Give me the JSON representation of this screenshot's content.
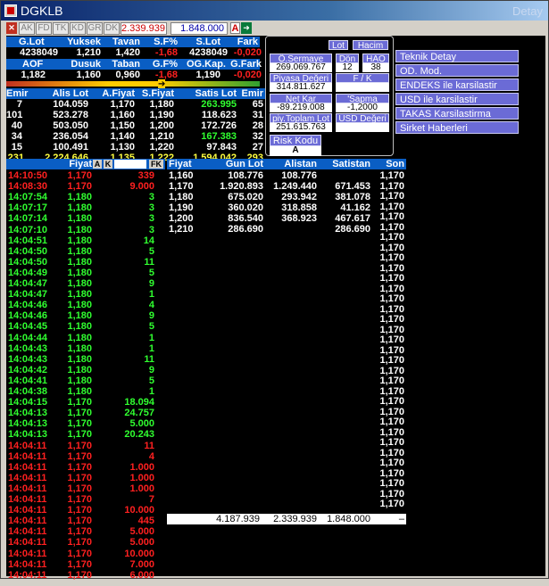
{
  "title": "DGKLB",
  "title_right": "Detay",
  "toolbar": {
    "tabs": [
      "AK",
      "FD",
      "TK",
      "KD",
      "GR",
      "DK"
    ],
    "value1": "2.339.939",
    "value2": "1.848.000",
    "a_label": "A"
  },
  "depth_header1": {
    "glot": "G.Lot",
    "yuksek": "Yuksek",
    "tavan": "Tavan",
    "sf": "S.F%",
    "slot": "S.Lot",
    "fark": "Fark"
  },
  "depth_row1": {
    "glot": "4238049",
    "yuksek": "1,210",
    "tavan": "1,420",
    "sf": "-1,68",
    "slot": "4238049",
    "fark": "-0,020"
  },
  "depth_header2": {
    "aof": "AOF",
    "dusuk": "Dusuk",
    "taban": "Taban",
    "gf": "G.F%",
    "ogkap": "OG.Kap.",
    "gfark": "G.Fark"
  },
  "depth_row2": {
    "aof": "1,182",
    "dusuk": "1,160",
    "taban": "0,960",
    "gf": "-1,68",
    "ogkap": "1,190",
    "gfark": "-0,020"
  },
  "order_header": {
    "emir": "Emir",
    "alis_lot": "Alis Lot",
    "afiyat": "A.Fiyat",
    "sfiyat": "S.Fiyat",
    "satis_lot": "Satis Lot",
    "emir2": "Emir"
  },
  "orders": [
    {
      "e": "7",
      "al": "104.059",
      "af": "1,170",
      "sf": "1,180",
      "sl": "263.995",
      "e2": "65",
      "slc": "g"
    },
    {
      "e": "101",
      "al": "523.278",
      "af": "1,160",
      "sf": "1,190",
      "sl": "118.623",
      "e2": "31",
      "slc": "w"
    },
    {
      "e": "40",
      "al": "503.050",
      "af": "1,150",
      "sf": "1,200",
      "sl": "172.726",
      "e2": "28",
      "slc": "w"
    },
    {
      "e": "34",
      "al": "236.054",
      "af": "1,140",
      "sf": "1,210",
      "sl": "167.383",
      "e2": "32",
      "slc": "g"
    },
    {
      "e": "15",
      "al": "100.491",
      "af": "1,130",
      "sf": "1,220",
      "sl": "97.843",
      "e2": "27",
      "slc": "w"
    }
  ],
  "order_total": {
    "e": "231",
    "al": "2.224.646",
    "af": "1,135",
    "sf": "1,222",
    "sl": "1.594.042",
    "e2": "293"
  },
  "summary": {
    "lot": "Lot",
    "hacim": "Hacim",
    "o_sermaye_label": "Ö.Sermaye",
    "o_sermaye": "269.069.767",
    "don_label": "Dön",
    "don": "12",
    "hao_label": "HAO",
    "hao": "38",
    "piyasa_label": "Piyasa Değeri",
    "piyasa": "314.811.627",
    "fk_label": "F / K",
    "fk": "",
    "netkar_label": "Net Kar",
    "netkar": "-89.219.008",
    "sapma_label": "'Sapma",
    "sapma": "-1,2000",
    "piy_label": "piy.Toplam Lot",
    "piy": "251.615.763",
    "usd_label": "USD Değeri",
    "usd": "",
    "risk_label": "Risk Kodu",
    "risk": "A"
  },
  "right_menu": [
    "Teknik Detay",
    "OD. Mod.",
    "ENDEKS ile karsilastir",
    "USD ile karsilastir",
    "TAKAS Karsilastirma",
    "Sirket Haberleri"
  ],
  "trades_header": {
    "fiyat": "Fiyat",
    "a": "A",
    "k": "K",
    "fk": "FK"
  },
  "trades": [
    [
      "14:10:50",
      "1,170",
      "339",
      "r"
    ],
    [
      "14:08:30",
      "1,170",
      "9.000",
      "r"
    ],
    [
      "14:07:54",
      "1,180",
      "3",
      "g"
    ],
    [
      "14:07:17",
      "1,180",
      "3",
      "g"
    ],
    [
      "14:07:14",
      "1,180",
      "3",
      "g"
    ],
    [
      "14:07:10",
      "1,180",
      "3",
      "g"
    ],
    [
      "14:04:51",
      "1,180",
      "14",
      "g"
    ],
    [
      "14:04:50",
      "1,180",
      "5",
      "g"
    ],
    [
      "14:04:50",
      "1,180",
      "11",
      "g"
    ],
    [
      "14:04:49",
      "1,180",
      "5",
      "g"
    ],
    [
      "14:04:47",
      "1,180",
      "9",
      "g"
    ],
    [
      "14:04:47",
      "1,180",
      "1",
      "g"
    ],
    [
      "14:04:46",
      "1,180",
      "4",
      "g"
    ],
    [
      "14:04:46",
      "1,180",
      "9",
      "g"
    ],
    [
      "14:04:45",
      "1,180",
      "5",
      "g"
    ],
    [
      "14:04:44",
      "1,180",
      "1",
      "g"
    ],
    [
      "14:04:43",
      "1,180",
      "1",
      "g"
    ],
    [
      "14:04:43",
      "1,180",
      "11",
      "g"
    ],
    [
      "14:04:42",
      "1,180",
      "9",
      "g"
    ],
    [
      "14:04:41",
      "1,180",
      "5",
      "g"
    ],
    [
      "14:04:38",
      "1,180",
      "1",
      "g"
    ],
    [
      "14:04:15",
      "1,170",
      "18.094",
      "g"
    ],
    [
      "14:04:13",
      "1,170",
      "24.757",
      "g"
    ],
    [
      "14:04:13",
      "1,170",
      "5.000",
      "g"
    ],
    [
      "14:04:13",
      "1,170",
      "20.243",
      "g"
    ],
    [
      "14:04:11",
      "1,170",
      "11",
      "r"
    ],
    [
      "14:04:11",
      "1,170",
      "4",
      "r"
    ],
    [
      "14:04:11",
      "1,170",
      "1.000",
      "r"
    ],
    [
      "14:04:11",
      "1,170",
      "1.000",
      "r"
    ],
    [
      "14:04:11",
      "1,170",
      "1.000",
      "r"
    ],
    [
      "14:04:11",
      "1,170",
      "7",
      "r"
    ],
    [
      "14:04:11",
      "1,170",
      "10.000",
      "r"
    ],
    [
      "14:04:11",
      "1,170",
      "445",
      "r"
    ],
    [
      "14:04:11",
      "1,170",
      "5.000",
      "r"
    ],
    [
      "14:04:11",
      "1,170",
      "5.000",
      "r"
    ],
    [
      "14:04:11",
      "1,170",
      "10.000",
      "r"
    ],
    [
      "14:04:11",
      "1,170",
      "7.000",
      "r"
    ],
    [
      "14:04:11",
      "1,170",
      "6.000",
      "r"
    ]
  ],
  "book_header": {
    "fiyat": "Fiyat",
    "gun_lot": "Gun Lot",
    "alistan": "Alistan",
    "satistan": "Satistan",
    "son": "Son"
  },
  "book": [
    [
      "1,160",
      "108.776",
      "108.776",
      ""
    ],
    [
      "1,170",
      "1.920.893",
      "1.249.440",
      "671.453"
    ],
    [
      "1,180",
      "675.020",
      "293.942",
      "381.078"
    ],
    [
      "1,190",
      "360.020",
      "318.858",
      "41.162"
    ],
    [
      "1,200",
      "836.540",
      "368.923",
      "467.617"
    ],
    [
      "1,210",
      "286.690",
      "",
      "286.690"
    ]
  ],
  "son_value": "1,170",
  "son_count": 33,
  "book_total": {
    "gun": "4.187.939",
    "alis": "2.339.939",
    "satis": "1.848.000",
    "dash": "–"
  }
}
